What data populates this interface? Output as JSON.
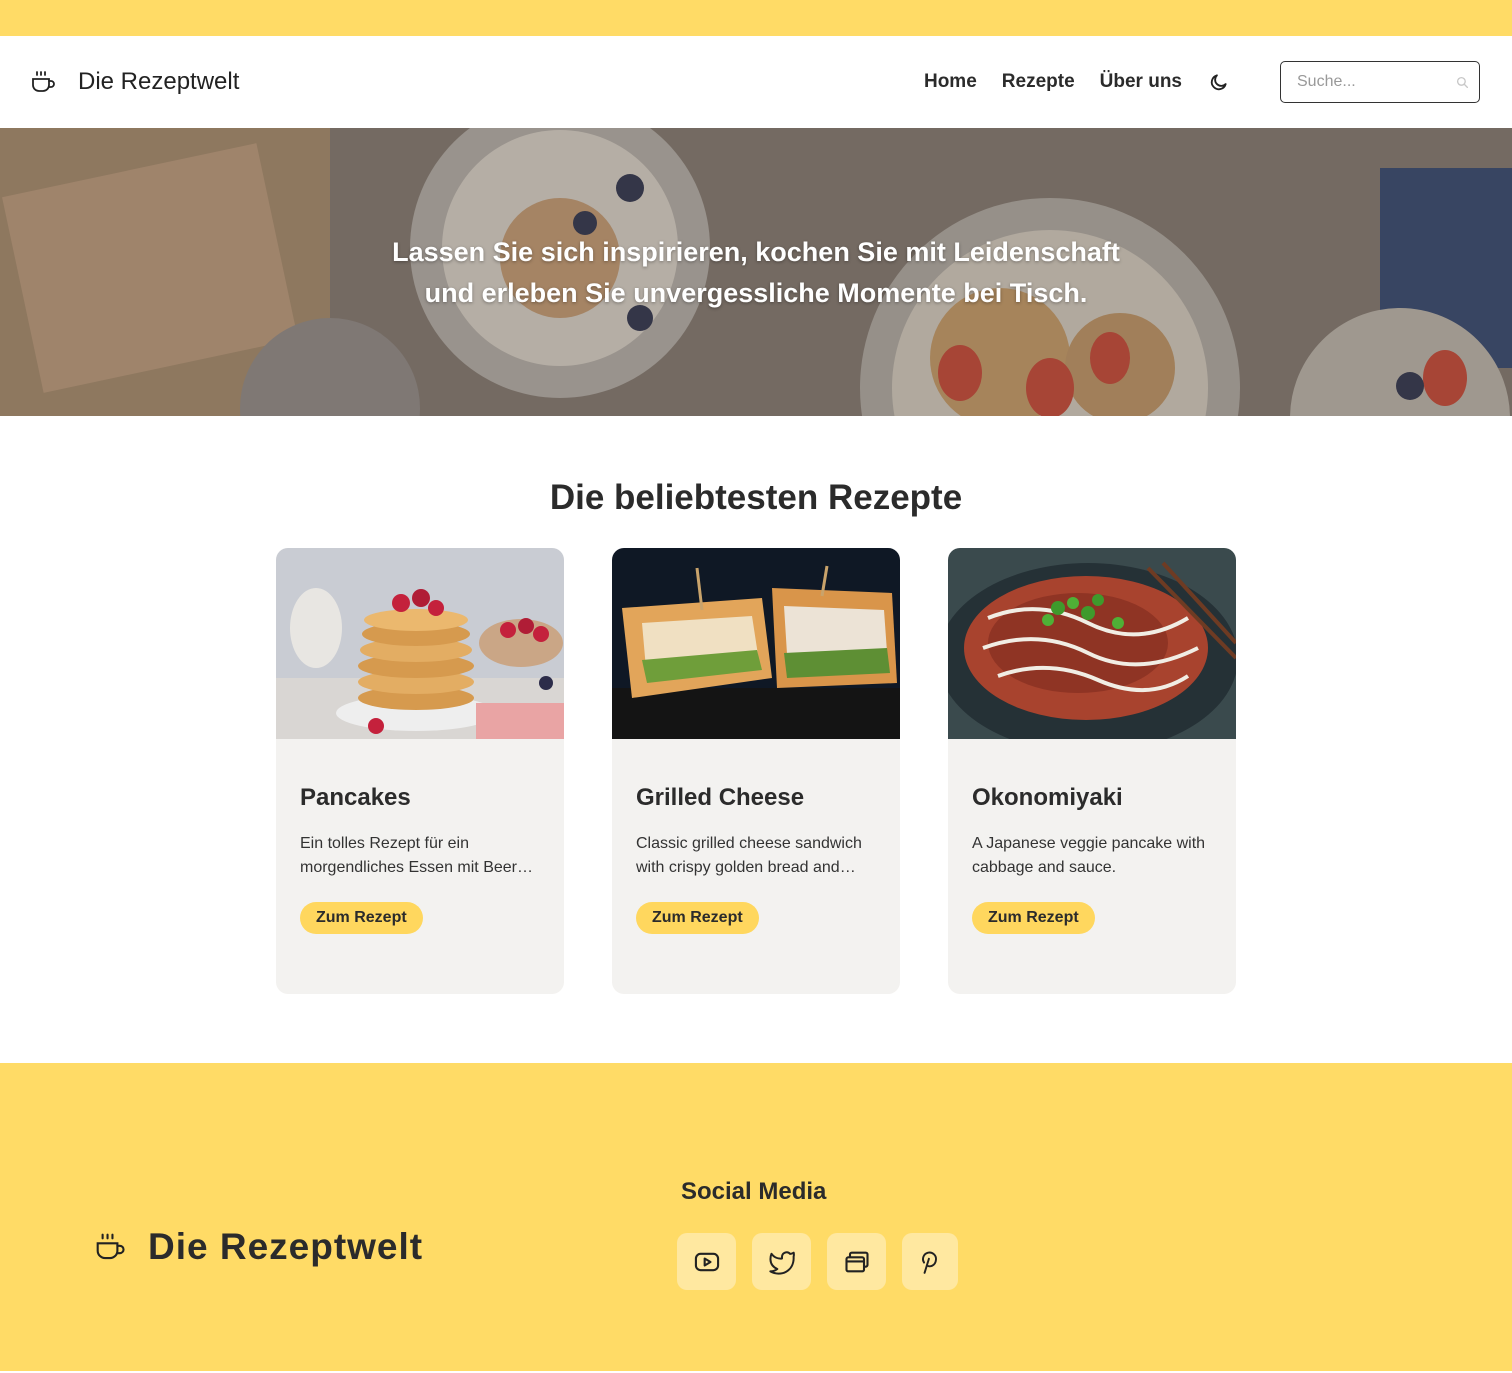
{
  "colors": {
    "accent": "#ffdb66",
    "button": "#ffd75e",
    "card_bg": "#f3f2f0",
    "text": "#2b2b2b"
  },
  "header": {
    "logo_icon": "coffee-cup-icon",
    "brand_name": "Die Rezeptwelt",
    "nav": [
      {
        "label": "Home"
      },
      {
        "label": "Rezepte"
      },
      {
        "label": "Über uns"
      }
    ],
    "theme_icon": "moon-icon",
    "search": {
      "placeholder": "Suche...",
      "value": "",
      "icon": "search-icon"
    }
  },
  "hero": {
    "line1": "Lassen Sie sich inspirieren, kochen Sie mit Leidenschaft",
    "line2": "und erleben Sie unvergessliche Momente bei Tisch."
  },
  "popular": {
    "heading": "Die beliebtesten Rezepte",
    "cards": [
      {
        "title": "Pancakes",
        "description": "Ein tolles Rezept für ein morgendliches Essen mit Beeren und Sirup.",
        "button": "Zum Rezept"
      },
      {
        "title": "Grilled Cheese",
        "description": "Classic grilled cheese sandwich with crispy golden bread and melted cheese.",
        "button": "Zum Rezept"
      },
      {
        "title": "Okonomiyaki",
        "description": "A Japanese veggie pancake with cabbage and sauce.",
        "button": "Zum Rezept"
      }
    ]
  },
  "footer": {
    "brand_name": "Die Rezeptwelt",
    "social_heading": "Social Media",
    "social_icons": [
      "youtube-icon",
      "twitter-icon",
      "browser-windows-icon",
      "pinterest-icon"
    ]
  }
}
